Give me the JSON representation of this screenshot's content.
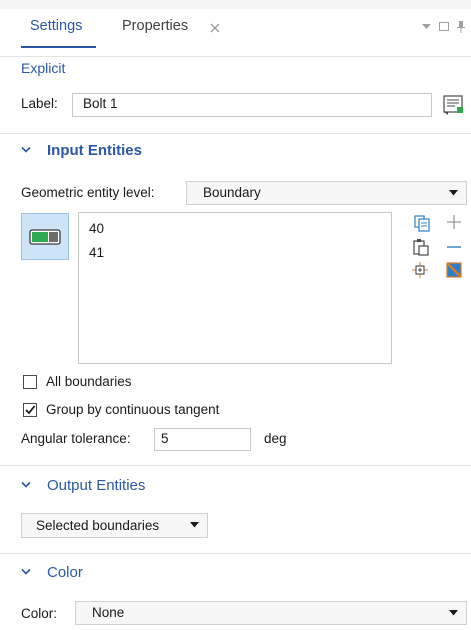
{
  "tabs": {
    "settings": "Settings",
    "properties": "Properties"
  },
  "node_title": "Explicit",
  "label_row": {
    "label": "Label:",
    "value": "Bolt 1"
  },
  "input_entities": {
    "header": "Input Entities",
    "geom_level_label": "Geometric entity level:",
    "geom_level_value": "Boundary",
    "selection": [
      "40",
      "41"
    ],
    "all_boundaries": {
      "label": "All boundaries",
      "checked": false
    },
    "group_tangent": {
      "label": "Group by continuous tangent",
      "checked": true
    },
    "angular_tol": {
      "label": "Angular tolerance:",
      "value": "5",
      "unit": "deg"
    }
  },
  "output_entities": {
    "header": "Output Entities",
    "dropdown_value": "Selected boundaries"
  },
  "color_section": {
    "header": "Color",
    "label": "Color:",
    "value": "None"
  },
  "colors": {
    "accent": "#2b58a4",
    "icon_blue": "#2f7fc8",
    "icon_orange": "#e07b1f",
    "toggle_bg": "#cde3f7"
  }
}
